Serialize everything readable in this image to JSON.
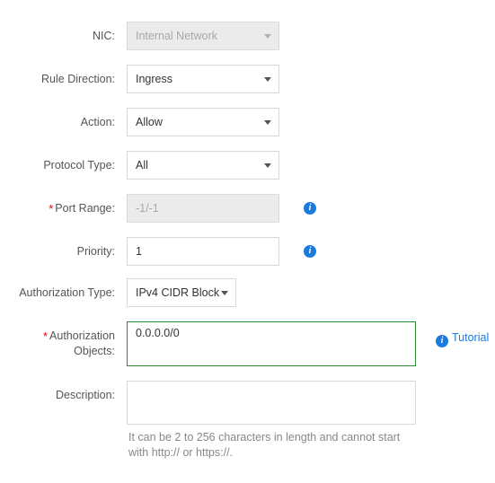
{
  "form": {
    "fields": [
      {
        "key": "nic",
        "label": "NIC:",
        "required": false,
        "type": "select",
        "value": "Internal Network",
        "disabled": true,
        "info": false
      },
      {
        "key": "rule_direction",
        "label": "Rule Direction:",
        "required": false,
        "type": "select",
        "value": "Ingress",
        "disabled": false,
        "info": false
      },
      {
        "key": "action",
        "label": "Action:",
        "required": false,
        "type": "select",
        "value": "Allow",
        "disabled": false,
        "info": false
      },
      {
        "key": "protocol_type",
        "label": "Protocol Type:",
        "required": false,
        "type": "select",
        "value": "All",
        "disabled": false,
        "info": false
      },
      {
        "key": "port_range",
        "label": "Port Range:",
        "required": true,
        "type": "input",
        "value": "-1/-1",
        "disabled": true,
        "info": true
      },
      {
        "key": "priority",
        "label": "Priority:",
        "required": false,
        "type": "input",
        "value": "1",
        "disabled": false,
        "info": true
      },
      {
        "key": "authorization_type",
        "label": "Authorization Type:",
        "required": false,
        "type": "select",
        "value": "IPv4 CIDR Block",
        "disabled": false,
        "info": false
      },
      {
        "key": "authorization_objects",
        "label_line1": "Authorization",
        "label_line2": "Objects:",
        "required": true,
        "type": "input",
        "value": "0.0.0.0/0",
        "disabled": false,
        "focused": true,
        "info": false
      },
      {
        "key": "description",
        "label": "Description:",
        "required": false,
        "type": "textarea",
        "value": "",
        "disabled": false,
        "info": false
      }
    ],
    "tutorial_link": "Tutorial",
    "description_hint": "It can be 2 to 256 characters in length and cannot start with http:// or https://.",
    "info_icon_glyph": "i",
    "required_marker": "*",
    "colors": {
      "accent_link": "#1a7ae0",
      "focus_border": "#2a8a33",
      "required_asterisk": "#e60012",
      "label_text": "#555555",
      "disabled_bg": "#ebebeb"
    }
  }
}
